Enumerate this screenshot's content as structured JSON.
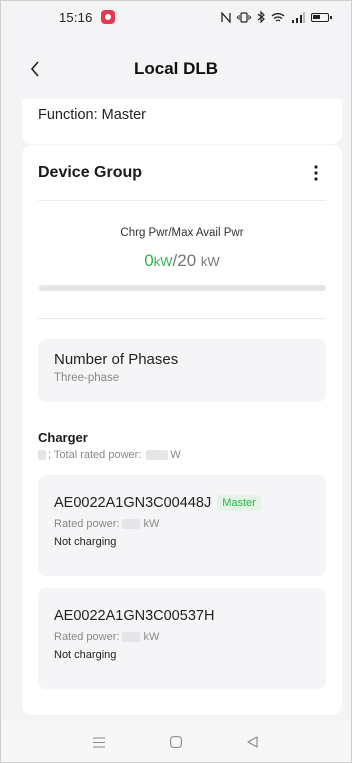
{
  "status_bar": {
    "time": "15:16",
    "icons": [
      "nfc-icon",
      "vibrate-icon",
      "bluetooth-icon",
      "wifi-icon",
      "signal-icon",
      "battery-icon"
    ]
  },
  "nav": {
    "title": "Local DLB",
    "back_icon": "chevron-left-icon"
  },
  "function_card": {
    "text": "Function: Master"
  },
  "device_group": {
    "title": "Device Group",
    "more_icon": "more-vertical-icon",
    "power_label": "Chrg Pwr/Max Avail Pwr",
    "current_value": "0",
    "current_unit": "kW",
    "separator": "/",
    "max_value": "20",
    "max_unit": "kW",
    "utilization_fraction": 0
  },
  "phases": {
    "title": "Number of Phases",
    "value": "Three-phase"
  },
  "charger_section": {
    "title": "Charger",
    "summary_prefix": "; Total rated power:",
    "summary_suffix": "W"
  },
  "chargers": [
    {
      "serial": "AE0022A1GN3C00448J",
      "badge": "Master",
      "rated_label": "Rated power:",
      "rated_unit": "kW",
      "status": "Not charging"
    },
    {
      "serial": "AE0022A1GN3C00537H",
      "badge": "",
      "rated_label": "Rated power:",
      "rated_unit": "kW",
      "status": "Not charging"
    }
  ],
  "system_nav": {
    "menu_icon": "menu-icon",
    "home_icon": "home-icon",
    "back_icon": "back-triangle-icon"
  },
  "colors": {
    "accent_green": "#2fb24c",
    "badge_bg": "#e3f4e6",
    "background": "#f4f4f6",
    "card": "#ffffff",
    "notification_red": "#e53950"
  }
}
